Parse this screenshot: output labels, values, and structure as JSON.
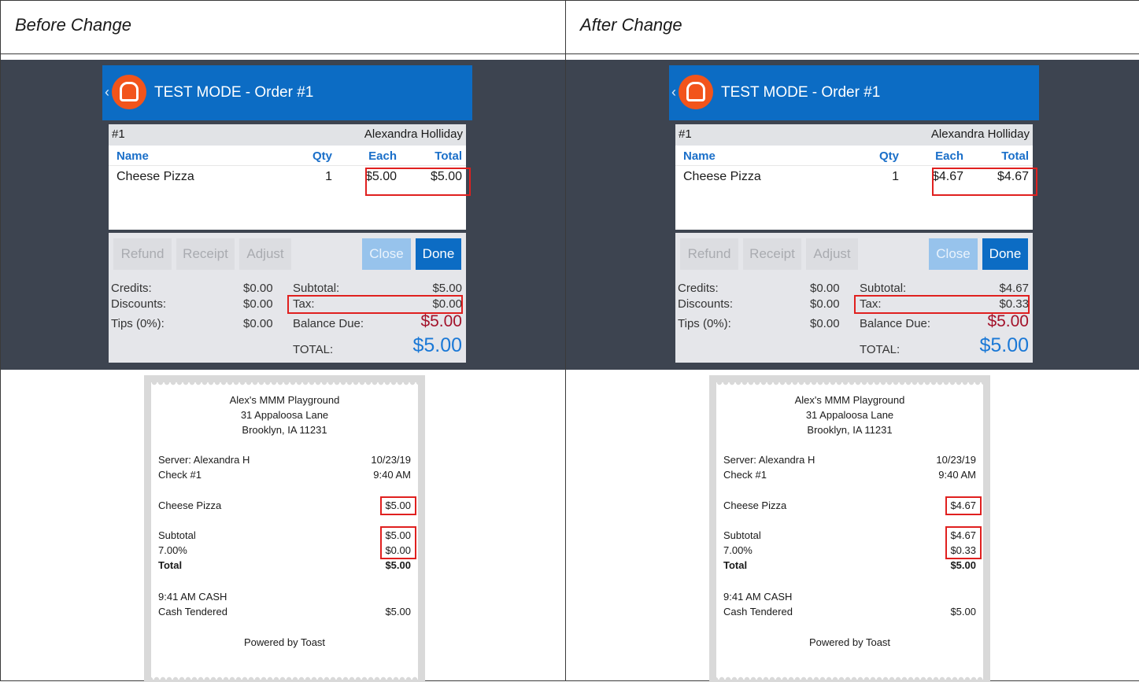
{
  "headers": {
    "before": "Before Change",
    "after": "After Change"
  },
  "pos": {
    "back": "‹",
    "title": "TEST MODE - Order #1",
    "check_no": "#1",
    "server": "Alexandra Holliday",
    "cols": {
      "name": "Name",
      "qty": "Qty",
      "each": "Each",
      "total": "Total"
    },
    "buttons": {
      "refund": "Refund",
      "receipt": "Receipt",
      "adjust": "Adjust",
      "close": "Close",
      "done": "Done"
    },
    "labels": {
      "credits": "Credits:",
      "discounts": "Discounts:",
      "tips": "Tips (0%):",
      "subtotal": "Subtotal:",
      "tax": "Tax:",
      "balance": "Balance Due:",
      "total": "TOTAL:"
    }
  },
  "receipt": {
    "store": "Alex's MMM Playground",
    "addr1": "31 Appaloosa Lane",
    "addr2": "Brooklyn, IA 11231",
    "server": "Server: Alexandra H",
    "date": "10/23/19",
    "check": "Check #1",
    "time": "9:40 AM",
    "subtotal_label": "Subtotal",
    "tax_label": "7.00%",
    "total_label": "Total",
    "payment": "9:41 AM CASH",
    "tendered_label": "Cash Tendered",
    "footer": "Powered by Toast"
  },
  "before": {
    "item": {
      "name": "Cheese Pizza",
      "qty": "1",
      "each": "$5.00",
      "total": "$5.00"
    },
    "credits": "$0.00",
    "discounts": "$0.00",
    "tips": "$0.00",
    "subtotal": "$5.00",
    "tax": "$0.00",
    "balance": "$5.00",
    "total": "$5.00",
    "r_item": "$5.00",
    "r_subtotal": "$5.00",
    "r_tax": "$0.00",
    "r_total": "$5.00",
    "r_tendered": "$5.00"
  },
  "after": {
    "item": {
      "name": "Cheese Pizza",
      "qty": "1",
      "each": "$4.67",
      "total": "$4.67"
    },
    "credits": "$0.00",
    "discounts": "$0.00",
    "tips": "$0.00",
    "subtotal": "$4.67",
    "tax": "$0.33",
    "balance": "$5.00",
    "total": "$5.00",
    "r_item": "$4.67",
    "r_subtotal": "$4.67",
    "r_tax": "$0.33",
    "r_total": "$5.00",
    "r_tendered": "$5.00"
  },
  "colors": {
    "toast_blue": "#0c6cc4",
    "toast_orange": "#f2541b",
    "highlight_red": "#e0201f",
    "balance_red": "#a3122a"
  }
}
